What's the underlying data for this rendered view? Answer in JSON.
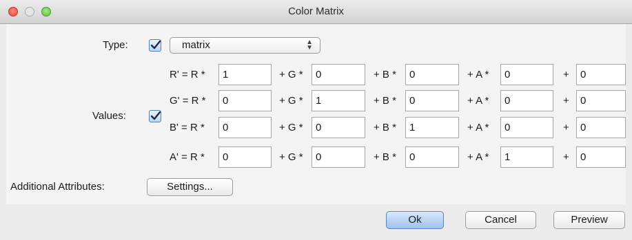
{
  "window": {
    "title": "Color Matrix"
  },
  "type_row": {
    "label": "Type:",
    "selected": "matrix",
    "checked": true
  },
  "values_row": {
    "label": "Values:",
    "checked": true,
    "rows": [
      {
        "prefix": "R' = R *",
        "cells": [
          "1",
          "0",
          "0",
          "0",
          "0"
        ]
      },
      {
        "prefix": "G' = R *",
        "cells": [
          "0",
          "1",
          "0",
          "0",
          "0"
        ]
      },
      {
        "prefix": "B' = R *",
        "cells": [
          "0",
          "0",
          "1",
          "0",
          "0"
        ]
      },
      {
        "prefix": "A' = R *",
        "cells": [
          "0",
          "0",
          "0",
          "1",
          "0"
        ]
      }
    ],
    "terms": {
      "g": "+ G *",
      "b": "+ B *",
      "a": "+ A *",
      "plus": "+"
    }
  },
  "attributes": {
    "label": "Additional Attributes:",
    "button": "Settings..."
  },
  "buttons": {
    "ok": "Ok",
    "cancel": "Cancel",
    "preview": "Preview"
  }
}
